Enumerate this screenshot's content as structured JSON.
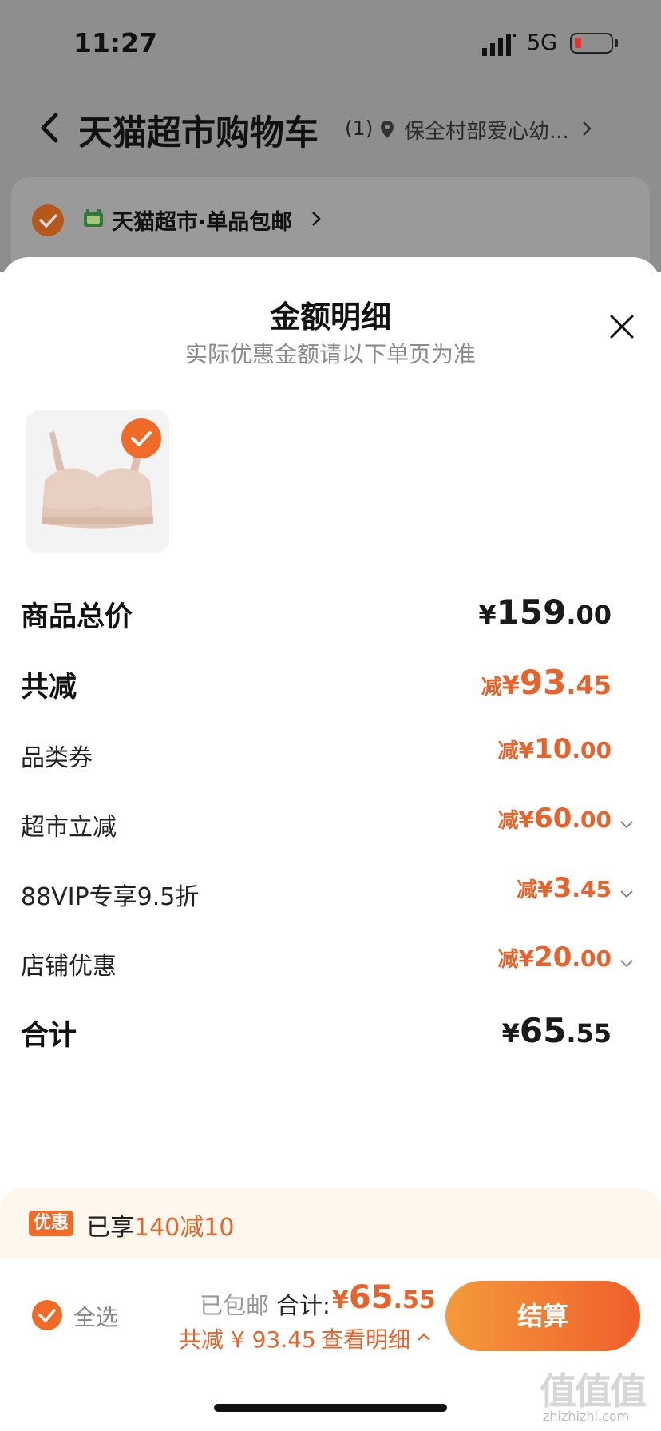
{
  "status_bar": {
    "time": "11:27",
    "network": "5G"
  },
  "cart_header": {
    "title": "天猫超市购物车",
    "count": "(1)",
    "location": "保全村部爱心幼..."
  },
  "store": {
    "name": "天猫超市·单品包邮"
  },
  "sheet": {
    "title": "金额明细",
    "subtitle": "实际优惠金额请以下单页为准",
    "rows": [
      {
        "label": "商品总价",
        "prefix": "",
        "yen": "¥",
        "int": "159",
        "dec": ".00"
      },
      {
        "label": "共减",
        "prefix": "减",
        "yen": "¥",
        "int": "93",
        "dec": ".45"
      },
      {
        "label": "品类券",
        "prefix": "减",
        "yen": "¥",
        "int": "10",
        "dec": ".00"
      },
      {
        "label": "超市立减",
        "prefix": "减",
        "yen": "¥",
        "int": "60",
        "dec": ".00"
      },
      {
        "label": "88VIP专享9.5折",
        "prefix": "减",
        "yen": "¥",
        "int": "3",
        "dec": ".45"
      },
      {
        "label": "店铺优惠",
        "prefix": "减",
        "yen": "¥",
        "int": "20",
        "dec": ".00"
      },
      {
        "label": "合计",
        "prefix": "",
        "yen": "¥",
        "int": "65",
        "dec": ".55"
      }
    ]
  },
  "promo": {
    "badge": "优惠",
    "text": "已享",
    "highlight": "140减10"
  },
  "bottom_bar": {
    "select_all": "全选",
    "shipping": "已包邮",
    "total_label": "合计:",
    "total_yen": "¥",
    "total_int": "65",
    "total_dec": ".55",
    "discount": "共减 ¥ 93.45",
    "detail_link": "查看明细",
    "checkout": "结算"
  },
  "watermark": {
    "text": "值值值",
    "url": "zhizhizhi.com"
  },
  "colors": {
    "accent": "#f06a28",
    "discount_text": "#e8632b",
    "dim_overlay": "#8e8e8e"
  }
}
